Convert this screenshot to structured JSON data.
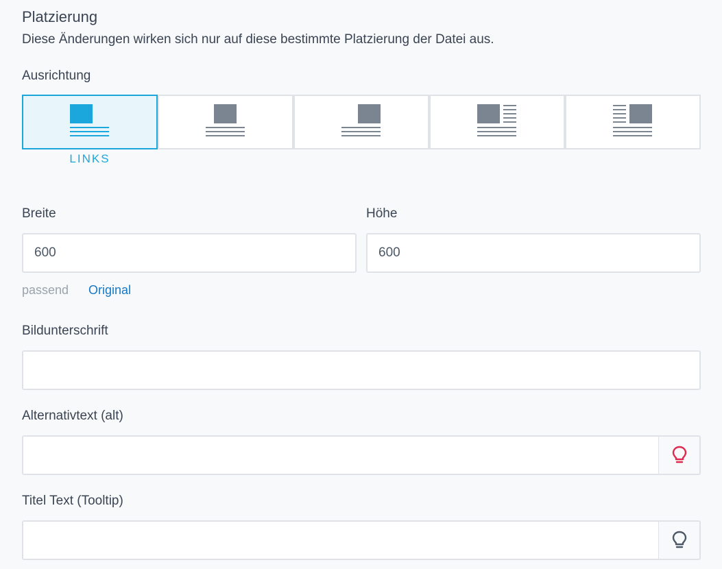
{
  "section": {
    "title": "Platzierung",
    "description": "Diese Änderungen wirken sich nur auf diese bestimmte Platzierung der Datei aus."
  },
  "alignment": {
    "label": "Ausrichtung",
    "selected_caption": "LINKS",
    "options": [
      {
        "icon": "align-left-icon",
        "active": true
      },
      {
        "icon": "align-center-icon",
        "active": false
      },
      {
        "icon": "align-right-icon",
        "active": false
      },
      {
        "icon": "float-left-icon",
        "active": false
      },
      {
        "icon": "float-right-icon",
        "active": false
      }
    ]
  },
  "size": {
    "width_label": "Breite",
    "width_value": "600",
    "height_label": "Höhe",
    "height_value": "600",
    "fit_link": "passend",
    "original_link": "Original"
  },
  "caption": {
    "label": "Bildunterschrift",
    "value": ""
  },
  "alt_text": {
    "label": "Alternativtext (alt)",
    "value": "",
    "addon_icon": "lightbulb-icon",
    "addon_color": "#e0284f"
  },
  "title_text": {
    "label": "Titel Text (Tooltip)",
    "value": "",
    "addon_icon": "lightbulb-icon",
    "addon_color": "#4d5866"
  },
  "colors": {
    "accent": "#1ba7dc",
    "link": "#1678c2",
    "icon_gray": "#7b8591"
  }
}
